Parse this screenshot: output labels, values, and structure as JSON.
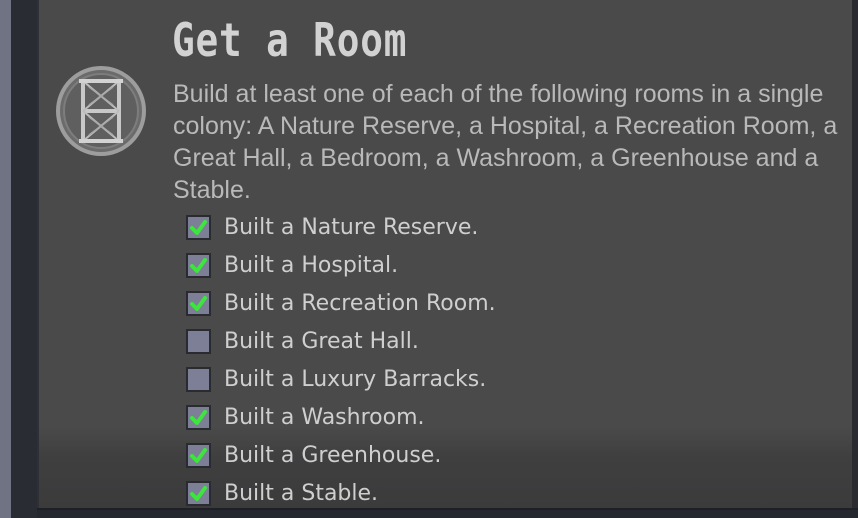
{
  "achievement": {
    "title": "Get a Room",
    "icon": "shelf-icon",
    "description": "Build at least one of each of the following rooms in a single colony: A Nature Reserve, a Hospital, a Recreation Room, a Great Hall, a Bedroom, a Washroom, a Greenhouse and a Stable."
  },
  "requirements": [
    {
      "label": "Built a Nature Reserve.",
      "checked": true
    },
    {
      "label": "Built a Hospital.",
      "checked": true
    },
    {
      "label": "Built a Recreation Room.",
      "checked": true
    },
    {
      "label": "Built a Great Hall.",
      "checked": false
    },
    {
      "label": "Built a Luxury Barracks.",
      "checked": false
    },
    {
      "label": "Built a Washroom.",
      "checked": true
    },
    {
      "label": "Built a Greenhouse.",
      "checked": true
    },
    {
      "label": "Built a Stable.",
      "checked": true
    }
  ],
  "colors": {
    "check_mark": "#3ee53e",
    "checkbox_fill": "#7c7f96",
    "panel_background": "#4a4a4a"
  }
}
